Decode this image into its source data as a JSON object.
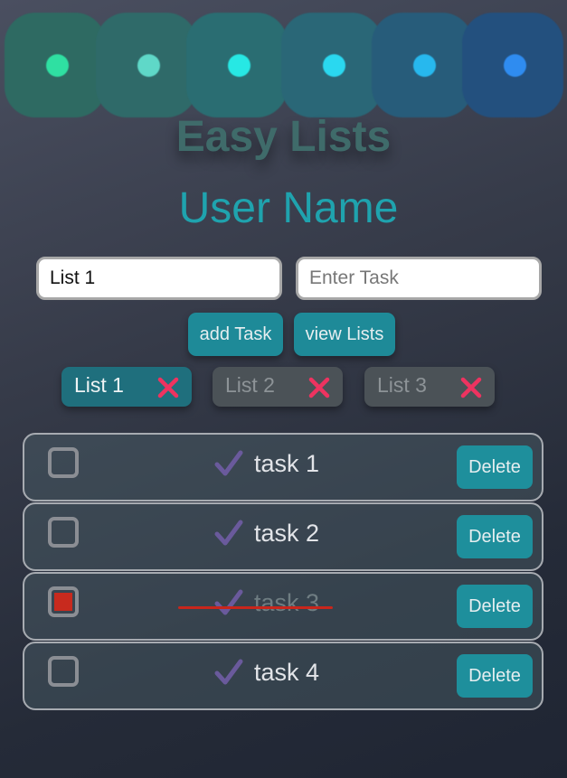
{
  "header": {
    "dots": [
      {
        "tile": "#2e6a62",
        "dot": "#2fe0a2"
      },
      {
        "tile": "#2f6a69",
        "dot": "#5fd8c8"
      },
      {
        "tile": "#2a6d72",
        "dot": "#27e8e4"
      },
      {
        "tile": "#2a6777",
        "dot": "#2ad8f0"
      },
      {
        "tile": "#275c7a",
        "dot": "#27b8ee"
      },
      {
        "tile": "#23507e",
        "dot": "#2f8cf0"
      }
    ],
    "app_title": "Easy Lists",
    "user_name": "User Name"
  },
  "form": {
    "list_value": "List 1",
    "task_placeholder": "Enter Task",
    "add_label": "add Task",
    "view_label": "view Lists"
  },
  "lists": [
    {
      "label": "List 1",
      "active": true
    },
    {
      "label": "List 2",
      "active": false
    },
    {
      "label": "List 3",
      "active": false
    }
  ],
  "tasks": [
    {
      "label": "task 1",
      "done": false,
      "delete_label": "Delete"
    },
    {
      "label": "task 2",
      "done": false,
      "delete_label": "Delete"
    },
    {
      "label": "task 3",
      "done": true,
      "delete_label": "Delete"
    },
    {
      "label": "task 4",
      "done": false,
      "delete_label": "Delete"
    }
  ],
  "colors": {
    "accent": "#1fa3ae",
    "button": "#1e8a98",
    "tab_active": "#1f6f7d",
    "tab_inactive": "#4b5257",
    "close_icon": "#ee3360",
    "check_icon": "#6a5a9c",
    "done_checkbox": "#c82a1e",
    "strike": "#c8261c"
  },
  "icons": {
    "remove_list": "close-x-icon",
    "task_mark": "checkmark-icon"
  }
}
